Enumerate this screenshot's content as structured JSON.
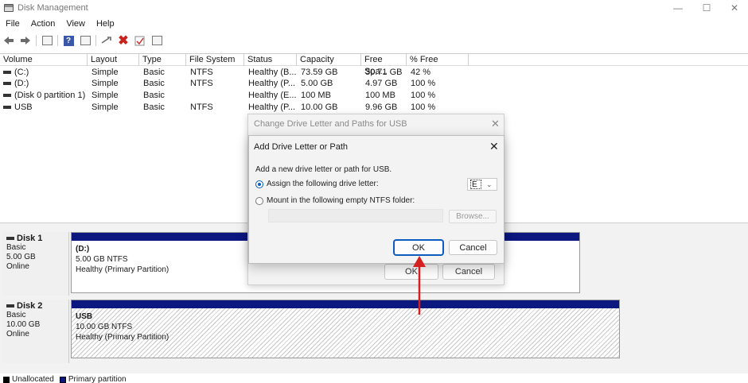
{
  "window": {
    "title": "Disk Management"
  },
  "window_controls": {
    "minimize": "—",
    "maximize": "☐",
    "close": "✕"
  },
  "menu": [
    "File",
    "Action",
    "View",
    "Help"
  ],
  "toolbar": {
    "icons": [
      "back-arrow-icon",
      "forward-arrow-icon",
      "disk-list-icon",
      "help-icon",
      "properties-icon",
      "connect-icon",
      "delete-icon",
      "check-icon",
      "volume-list-icon"
    ],
    "help_glyph": "?",
    "delete_glyph": "✖"
  },
  "volume_table": {
    "columns": [
      "Volume",
      "Layout",
      "Type",
      "File System",
      "Status",
      "Capacity",
      "Free Spa...",
      "% Free"
    ],
    "rows": [
      {
        "volume": "(C:)",
        "layout": "Simple",
        "type": "Basic",
        "fs": "NTFS",
        "status": "Healthy (B...",
        "capacity": "73.59 GB",
        "free": "30.71 GB",
        "pct": "42 %"
      },
      {
        "volume": "(D:)",
        "layout": "Simple",
        "type": "Basic",
        "fs": "NTFS",
        "status": "Healthy (P...",
        "capacity": "5.00 GB",
        "free": "4.97 GB",
        "pct": "100 %"
      },
      {
        "volume": "(Disk 0 partition 1)",
        "layout": "Simple",
        "type": "Basic",
        "fs": "",
        "status": "Healthy (E...",
        "capacity": "100 MB",
        "free": "100 MB",
        "pct": "100 %"
      },
      {
        "volume": "USB",
        "layout": "Simple",
        "type": "Basic",
        "fs": "NTFS",
        "status": "Healthy (P...",
        "capacity": "10.00 GB",
        "free": "9.96 GB",
        "pct": "100 %"
      }
    ]
  },
  "disks": [
    {
      "name": "Disk 1",
      "type": "Basic",
      "size": "5.00 GB",
      "state": "Online",
      "partition": {
        "title": "(D:)",
        "size_fs": "5.00 GB NTFS",
        "status": "Healthy (Primary Partition)"
      }
    },
    {
      "name": "Disk 2",
      "type": "Basic",
      "size": "10.00 GB",
      "state": "Online",
      "partition": {
        "title": "USB",
        "size_fs": "10.00 GB NTFS",
        "status": "Healthy (Primary Partition)"
      }
    }
  ],
  "legend": {
    "unallocated": "Unallocated",
    "primary": "Primary partition",
    "unallocated_color": "#000000",
    "primary_color": "#0a1880"
  },
  "dialog_bg": {
    "title": "Change Drive Letter and Paths for USB",
    "ok": "OK",
    "cancel": "Cancel"
  },
  "dialog_fg": {
    "title": "Add Drive Letter or Path",
    "description": "Add a new drive letter or path for USB.",
    "option_assign": "Assign the following drive letter:",
    "option_mount": "Mount in the following empty NTFS folder:",
    "drive_letter": "E",
    "browse": "Browse...",
    "ok": "OK",
    "cancel": "Cancel"
  },
  "colors": {
    "accent": "#0b5cbd",
    "annotation_arrow": "#d61f1f"
  }
}
